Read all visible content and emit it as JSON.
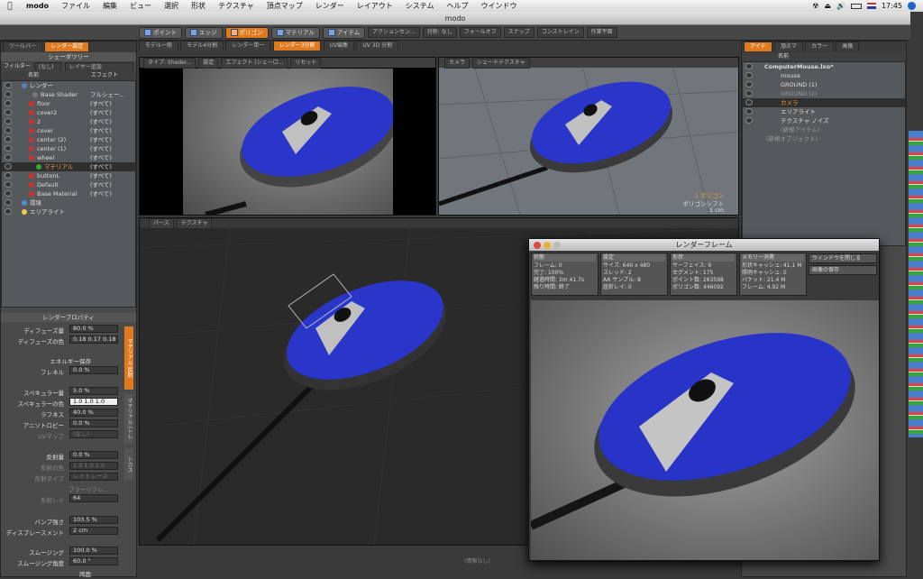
{
  "menubar": {
    "app": "modo",
    "items": [
      "ファイル",
      "編集",
      "ビュー",
      "選択",
      "形状",
      "テクスチャ",
      "頂点マップ",
      "レンダー",
      "レイアウト",
      "システム",
      "ヘルプ",
      "ウインドウ"
    ],
    "clock": "17:45"
  },
  "window": {
    "title": "modo"
  },
  "toolbar": {
    "point": "ポイント",
    "edge": "エッジ",
    "polygon": "ポリゴン",
    "material": "マテリアル",
    "item": "アイテム",
    "action": "アクションセン...",
    "symmetry": "対称: なし",
    "falloff": "フォールオフ",
    "snap": "スナップ",
    "constraint": "コンストレイン",
    "workplane": "作業平面"
  },
  "left": {
    "tabs": [
      "ツールバー",
      "レンダー設定"
    ],
    "header": "シェーダツリー",
    "filter_label": "フィルター",
    "filter_value": "(なし)",
    "layer_mode": "レイヤー追加",
    "col_name": "名前",
    "col_effect": "エフェクト",
    "tree": [
      {
        "name": "レンダー",
        "effect": ""
      },
      {
        "name": "Base Shader",
        "effect": "フルシェー..."
      },
      {
        "name": "floor",
        "effect": "(すべて)"
      },
      {
        "name": "cover2",
        "effect": "(すべて)"
      },
      {
        "name": "2",
        "effect": "(すべて)"
      },
      {
        "name": "cover",
        "effect": "(すべて)"
      },
      {
        "name": "center (2)",
        "effect": "(すべて)"
      },
      {
        "name": "center (1)",
        "effect": "(すべて)"
      },
      {
        "name": "wheel",
        "effect": "(すべて)"
      },
      {
        "name": "マテリアル",
        "effect": "(すべて)"
      },
      {
        "name": "buttonL",
        "effect": "(すべて)"
      },
      {
        "name": "Default",
        "effect": "(すべて)"
      },
      {
        "name": "Base Material",
        "effect": "(すべて)"
      },
      {
        "name": "環境",
        "effect": ""
      },
      {
        "name": "エリアライト",
        "effect": ""
      }
    ],
    "props_header": "レンダープロパティ",
    "props": {
      "diffuse_amount_label": "ディフューズ量",
      "diffuse_amount": "80.0 %",
      "diffuse_color_label": "ディフューズの色",
      "diffuse_color": "0.18  0.17  0.18",
      "energy": "エネルギー保存",
      "fresnel_label": "フレネル",
      "fresnel": "0.0 %",
      "spec_amount_label": "スペキュラー量",
      "spec_amount": "5.0 %",
      "spec_color_label": "スペキュラーの色",
      "spec_color": "1.0   1.0   1.0",
      "rough_label": "ラフネス",
      "rough": "40.0 %",
      "aniso_label": "アニソトロピー",
      "aniso": "0.0 %",
      "uvmap_label": "UVマップ",
      "uvmap": "(なし)",
      "refl_label": "反射量",
      "refl": "0.0 %",
      "refl_color_label": "反射の色",
      "refl_color": "1.0   1.0   1.0",
      "refl_type_label": "反射タイプ",
      "refl_type": "レイトレース",
      "blurry": "ブラーリフレ...",
      "refl_rays_label": "反射レイ",
      "refl_rays": "64",
      "bump_label": "バンプ強さ",
      "bump": "103.5 %",
      "disp_label": "ディスプレースメント",
      "disp": "2 cm",
      "smooth_label": "スムージング",
      "smooth": "100.0 %",
      "smooth_angle_label": "スムージング角度",
      "smooth_angle": "60.0 °",
      "double": "両面"
    },
    "side_tabs": [
      "マテリアル 反射",
      "マテリアル (トレ",
      "トカス"
    ]
  },
  "viewports": {
    "tabs": [
      "モデル一般",
      "モデル4分割",
      "レンダー単一",
      "レンダー3分割",
      "UV編集",
      "UV 3D 分割"
    ],
    "tl": {
      "type": "タイプ: Shader...",
      "settings": "設定",
      "effect": "エフェクト (シェーロ...",
      "reset": "リセット"
    },
    "tr": {
      "camera": "カメラ",
      "shade": "シェードテクスチャ",
      "poly": "1 ポリゴン",
      "shift": "ポリゴンシフト",
      "unit": "1 cm"
    },
    "bottom": {
      "perspective": "パース",
      "texture": "テクスチャ",
      "status": "(情報なし)"
    }
  },
  "right": {
    "tabs": [
      "アイテ",
      "頂点マ",
      "カラー",
      "画像"
    ],
    "col_name": "名前",
    "items": [
      {
        "name": "ComputerMouse.lxo*"
      },
      {
        "name": "mouse"
      },
      {
        "name": "GROUND (1)"
      },
      {
        "name": "GROUND (2)"
      },
      {
        "name": "カメラ"
      },
      {
        "name": "エリアライト"
      },
      {
        "name": "テクスチャ ノイズ"
      },
      {
        "name": "(新規アイテム)"
      },
      {
        "name": "(新規オブジェクト)"
      }
    ]
  },
  "render_frame": {
    "title": "レンダーフレーム",
    "sections": [
      {
        "head": "状態",
        "lines": [
          "フレーム: 0",
          "完了: 100%",
          "経過時間: 3m 41.7s",
          "残り時間: 終了"
        ]
      },
      {
        "head": "設定",
        "lines": [
          "サイズ: 640 x 480",
          "スレッド: 2",
          "AA サンプル: 8",
          "屈折レイ: 0"
        ]
      },
      {
        "head": "形状",
        "lines": [
          "サーフェイス: 9",
          "セグメント: 175",
          "ポイント数: 263598",
          "ポリゴン数: 446092"
        ]
      },
      {
        "head": "メモリー消費",
        "lines": [
          "形状キャッシュ: 41.1 M",
          "照明キャッシュ: 0",
          "バケット: 21.4 M",
          "フレーム: 4.92 M"
        ]
      }
    ],
    "close": "ウィンドウを閉じる",
    "save": "画像の保存"
  }
}
